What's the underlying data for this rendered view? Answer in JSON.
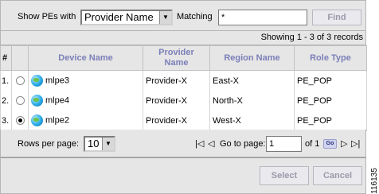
{
  "filter": {
    "show_label": "Show PEs with",
    "show_value": "Provider Name",
    "matching_label": "Matching",
    "matching_value": "*",
    "find_label": "Find"
  },
  "records": {
    "text": "Showing 1 - 3 of 3 records"
  },
  "table": {
    "headers": {
      "num": "#",
      "device": "Device Name",
      "provider": "Provider Name",
      "region": "Region Name",
      "role": "Role Type"
    },
    "rows": [
      {
        "num": "1.",
        "device": "mlpe3",
        "provider": "Provider-X",
        "region": "East-X",
        "role": "PE_POP",
        "selected": false
      },
      {
        "num": "2.",
        "device": "mlpe4",
        "provider": "Provider-X",
        "region": "North-X",
        "role": "PE_POP",
        "selected": false
      },
      {
        "num": "3.",
        "device": "mlpe2",
        "provider": "Provider-X",
        "region": "West-X",
        "role": "PE_POP",
        "selected": true
      }
    ]
  },
  "pagination": {
    "rows_per_page_label": "Rows per page:",
    "rows_per_page_value": "10",
    "goto_label": "Go to page:",
    "page_value": "1",
    "of_label": "of 1",
    "go_label": "Go"
  },
  "actions": {
    "select_label": "Select",
    "cancel_label": "Cancel"
  },
  "figure_id": "116135"
}
